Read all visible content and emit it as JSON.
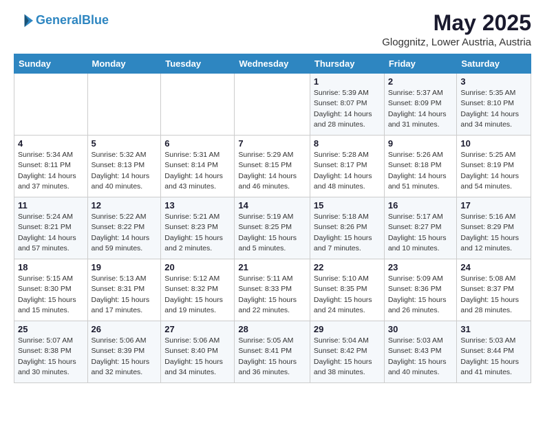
{
  "header": {
    "logo_general": "General",
    "logo_blue": "Blue",
    "month_year": "May 2025",
    "location": "Gloggnitz, Lower Austria, Austria"
  },
  "days_of_week": [
    "Sunday",
    "Monday",
    "Tuesday",
    "Wednesday",
    "Thursday",
    "Friday",
    "Saturday"
  ],
  "weeks": [
    [
      {
        "day": "",
        "info": ""
      },
      {
        "day": "",
        "info": ""
      },
      {
        "day": "",
        "info": ""
      },
      {
        "day": "",
        "info": ""
      },
      {
        "day": "1",
        "info": "Sunrise: 5:39 AM\nSunset: 8:07 PM\nDaylight: 14 hours\nand 28 minutes."
      },
      {
        "day": "2",
        "info": "Sunrise: 5:37 AM\nSunset: 8:09 PM\nDaylight: 14 hours\nand 31 minutes."
      },
      {
        "day": "3",
        "info": "Sunrise: 5:35 AM\nSunset: 8:10 PM\nDaylight: 14 hours\nand 34 minutes."
      }
    ],
    [
      {
        "day": "4",
        "info": "Sunrise: 5:34 AM\nSunset: 8:11 PM\nDaylight: 14 hours\nand 37 minutes."
      },
      {
        "day": "5",
        "info": "Sunrise: 5:32 AM\nSunset: 8:13 PM\nDaylight: 14 hours\nand 40 minutes."
      },
      {
        "day": "6",
        "info": "Sunrise: 5:31 AM\nSunset: 8:14 PM\nDaylight: 14 hours\nand 43 minutes."
      },
      {
        "day": "7",
        "info": "Sunrise: 5:29 AM\nSunset: 8:15 PM\nDaylight: 14 hours\nand 46 minutes."
      },
      {
        "day": "8",
        "info": "Sunrise: 5:28 AM\nSunset: 8:17 PM\nDaylight: 14 hours\nand 48 minutes."
      },
      {
        "day": "9",
        "info": "Sunrise: 5:26 AM\nSunset: 8:18 PM\nDaylight: 14 hours\nand 51 minutes."
      },
      {
        "day": "10",
        "info": "Sunrise: 5:25 AM\nSunset: 8:19 PM\nDaylight: 14 hours\nand 54 minutes."
      }
    ],
    [
      {
        "day": "11",
        "info": "Sunrise: 5:24 AM\nSunset: 8:21 PM\nDaylight: 14 hours\nand 57 minutes."
      },
      {
        "day": "12",
        "info": "Sunrise: 5:22 AM\nSunset: 8:22 PM\nDaylight: 14 hours\nand 59 minutes."
      },
      {
        "day": "13",
        "info": "Sunrise: 5:21 AM\nSunset: 8:23 PM\nDaylight: 15 hours\nand 2 minutes."
      },
      {
        "day": "14",
        "info": "Sunrise: 5:19 AM\nSunset: 8:25 PM\nDaylight: 15 hours\nand 5 minutes."
      },
      {
        "day": "15",
        "info": "Sunrise: 5:18 AM\nSunset: 8:26 PM\nDaylight: 15 hours\nand 7 minutes."
      },
      {
        "day": "16",
        "info": "Sunrise: 5:17 AM\nSunset: 8:27 PM\nDaylight: 15 hours\nand 10 minutes."
      },
      {
        "day": "17",
        "info": "Sunrise: 5:16 AM\nSunset: 8:29 PM\nDaylight: 15 hours\nand 12 minutes."
      }
    ],
    [
      {
        "day": "18",
        "info": "Sunrise: 5:15 AM\nSunset: 8:30 PM\nDaylight: 15 hours\nand 15 minutes."
      },
      {
        "day": "19",
        "info": "Sunrise: 5:13 AM\nSunset: 8:31 PM\nDaylight: 15 hours\nand 17 minutes."
      },
      {
        "day": "20",
        "info": "Sunrise: 5:12 AM\nSunset: 8:32 PM\nDaylight: 15 hours\nand 19 minutes."
      },
      {
        "day": "21",
        "info": "Sunrise: 5:11 AM\nSunset: 8:33 PM\nDaylight: 15 hours\nand 22 minutes."
      },
      {
        "day": "22",
        "info": "Sunrise: 5:10 AM\nSunset: 8:35 PM\nDaylight: 15 hours\nand 24 minutes."
      },
      {
        "day": "23",
        "info": "Sunrise: 5:09 AM\nSunset: 8:36 PM\nDaylight: 15 hours\nand 26 minutes."
      },
      {
        "day": "24",
        "info": "Sunrise: 5:08 AM\nSunset: 8:37 PM\nDaylight: 15 hours\nand 28 minutes."
      }
    ],
    [
      {
        "day": "25",
        "info": "Sunrise: 5:07 AM\nSunset: 8:38 PM\nDaylight: 15 hours\nand 30 minutes."
      },
      {
        "day": "26",
        "info": "Sunrise: 5:06 AM\nSunset: 8:39 PM\nDaylight: 15 hours\nand 32 minutes."
      },
      {
        "day": "27",
        "info": "Sunrise: 5:06 AM\nSunset: 8:40 PM\nDaylight: 15 hours\nand 34 minutes."
      },
      {
        "day": "28",
        "info": "Sunrise: 5:05 AM\nSunset: 8:41 PM\nDaylight: 15 hours\nand 36 minutes."
      },
      {
        "day": "29",
        "info": "Sunrise: 5:04 AM\nSunset: 8:42 PM\nDaylight: 15 hours\nand 38 minutes."
      },
      {
        "day": "30",
        "info": "Sunrise: 5:03 AM\nSunset: 8:43 PM\nDaylight: 15 hours\nand 40 minutes."
      },
      {
        "day": "31",
        "info": "Sunrise: 5:03 AM\nSunset: 8:44 PM\nDaylight: 15 hours\nand 41 minutes."
      }
    ]
  ]
}
